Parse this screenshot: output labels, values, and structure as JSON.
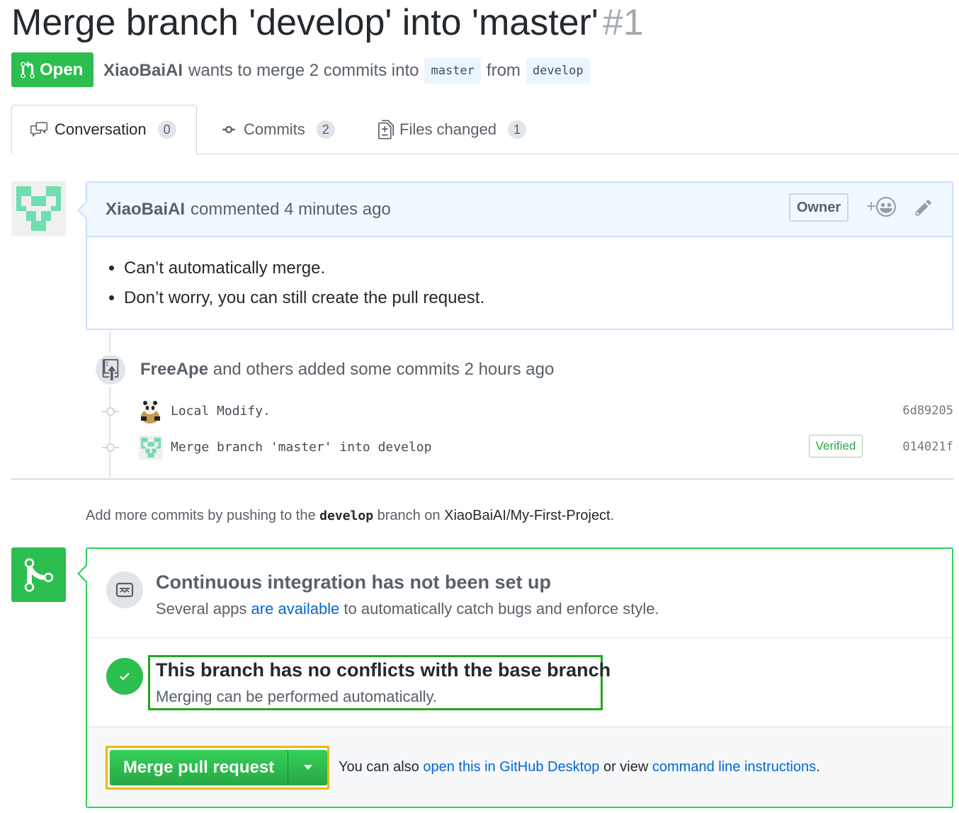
{
  "header": {
    "title": "Merge branch 'develop' into 'master'",
    "number": "#1",
    "state": "Open",
    "author": "XiaoBaiAI",
    "wants_text": "wants to merge 2 commits into",
    "base_branch": "master",
    "from_text": "from",
    "head_branch": "develop"
  },
  "tabs": [
    {
      "label": "Conversation",
      "count": "0",
      "icon": "comment-discussion-icon"
    },
    {
      "label": "Commits",
      "count": "2",
      "icon": "git-commit-icon"
    },
    {
      "label": "Files changed",
      "count": "1",
      "icon": "file-diff-icon"
    }
  ],
  "comment": {
    "author": "XiaoBaiAI",
    "action": "commented 4 minutes ago",
    "role": "Owner",
    "reaction_plus": "+",
    "bullets": [
      "Can’t automatically merge.",
      "Don’t worry, you can still create the pull request."
    ]
  },
  "commits_event": {
    "author": "FreeApe",
    "text": "and others added some commits 2 hours ago",
    "commits": [
      {
        "message": "Local Modify.",
        "sha": "6d89205",
        "verified": ""
      },
      {
        "message": "Merge branch 'master' into develop",
        "sha": "014021f",
        "verified": "Verified"
      }
    ]
  },
  "push_hint": {
    "prefix": "Add more commits by pushing to the",
    "branch": "develop",
    "middle": "branch on",
    "repo": "XiaoBaiAI/My-First-Project",
    "suffix": "."
  },
  "ci": {
    "title": "Continuous integration has not been set up",
    "desc_prefix": "Several apps",
    "desc_link": "are available",
    "desc_suffix": "to automatically catch bugs and enforce style."
  },
  "merge_status": {
    "title": "This branch has no conflicts with the base branch",
    "desc": "Merging can be performed automatically."
  },
  "merge_action": {
    "button_label": "Merge pull request",
    "also_prefix": "You can also",
    "desktop_link": "open this in GitHub Desktop",
    "or_view": "or view",
    "cli_link": "command line instructions",
    "suffix": "."
  },
  "colors": {
    "green": "#2cbe4e",
    "blue_link": "#0366d6",
    "highlight_green": "#22a722",
    "highlight_orange": "#f5b50a"
  }
}
